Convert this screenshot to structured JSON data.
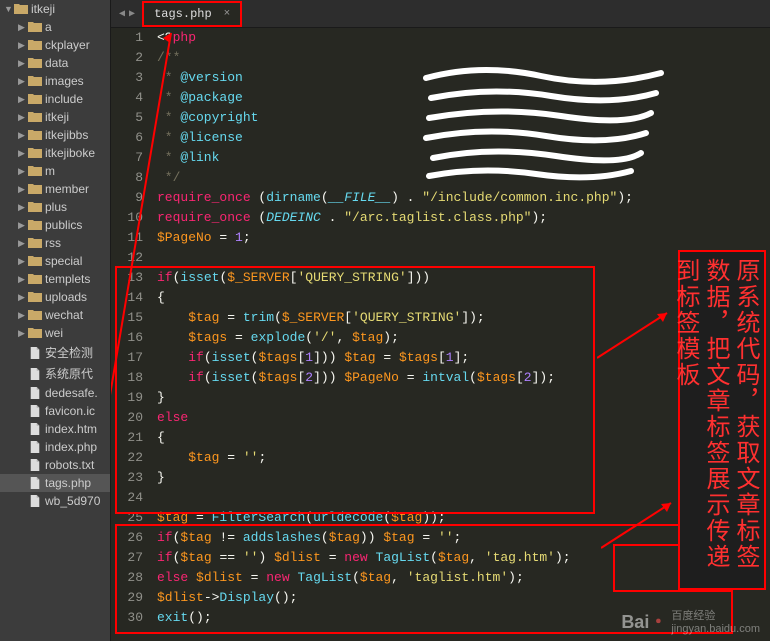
{
  "sidebar": {
    "root": "itkeji",
    "items": [
      {
        "type": "folder",
        "label": "a"
      },
      {
        "type": "folder",
        "label": "ckplayer"
      },
      {
        "type": "folder",
        "label": "data"
      },
      {
        "type": "folder",
        "label": "images"
      },
      {
        "type": "folder",
        "label": "include"
      },
      {
        "type": "folder",
        "label": "itkeji"
      },
      {
        "type": "folder",
        "label": "itkejibbs"
      },
      {
        "type": "folder",
        "label": "itkejiboke"
      },
      {
        "type": "folder",
        "label": "m"
      },
      {
        "type": "folder",
        "label": "member"
      },
      {
        "type": "folder",
        "label": "plus"
      },
      {
        "type": "folder",
        "label": "publics"
      },
      {
        "type": "folder",
        "label": "rss"
      },
      {
        "type": "folder",
        "label": "special"
      },
      {
        "type": "folder",
        "label": "templets"
      },
      {
        "type": "folder",
        "label": "uploads"
      },
      {
        "type": "folder",
        "label": "wechat"
      },
      {
        "type": "folder",
        "label": "wei"
      },
      {
        "type": "file",
        "label": "安全检测"
      },
      {
        "type": "file",
        "label": "系统原代"
      },
      {
        "type": "file",
        "label": "dedesafe."
      },
      {
        "type": "file",
        "label": "favicon.ic"
      },
      {
        "type": "file",
        "label": "index.htm"
      },
      {
        "type": "file",
        "label": "index.php"
      },
      {
        "type": "file",
        "label": "robots.txt"
      },
      {
        "type": "file",
        "label": "tags.php",
        "selected": true
      },
      {
        "type": "file",
        "label": "wb_5d970"
      }
    ]
  },
  "tab": {
    "label": "tags.php"
  },
  "code": {
    "lines": [
      {
        "n": 1,
        "t": [
          {
            "c": "punct",
            "s": "<?"
          },
          {
            "c": "keyword",
            "s": "php"
          }
        ]
      },
      {
        "n": 2,
        "t": [
          {
            "c": "comment",
            "s": "/**"
          }
        ]
      },
      {
        "n": 3,
        "t": [
          {
            "c": "comment",
            "s": " * "
          },
          {
            "c": "doctag",
            "s": "@version"
          }
        ]
      },
      {
        "n": 4,
        "t": [
          {
            "c": "comment",
            "s": " * "
          },
          {
            "c": "doctag",
            "s": "@package"
          }
        ]
      },
      {
        "n": 5,
        "t": [
          {
            "c": "comment",
            "s": " * "
          },
          {
            "c": "doctag",
            "s": "@copyright"
          }
        ]
      },
      {
        "n": 6,
        "t": [
          {
            "c": "comment",
            "s": " * "
          },
          {
            "c": "doctag",
            "s": "@license"
          }
        ]
      },
      {
        "n": 7,
        "t": [
          {
            "c": "comment",
            "s": " * "
          },
          {
            "c": "doctag",
            "s": "@link"
          }
        ]
      },
      {
        "n": 8,
        "t": [
          {
            "c": "comment",
            "s": " */"
          }
        ]
      },
      {
        "n": 9,
        "t": [
          {
            "c": "keyword",
            "s": "require_once"
          },
          {
            "c": "punct",
            "s": " ("
          },
          {
            "c": "func",
            "s": "dirname"
          },
          {
            "c": "punct",
            "s": "("
          },
          {
            "c": "const",
            "s": "__FILE__"
          },
          {
            "c": "punct",
            "s": ") . "
          },
          {
            "c": "string",
            "s": "\"/include/common.inc.php\""
          },
          {
            "c": "punct",
            "s": ");"
          }
        ]
      },
      {
        "n": 10,
        "t": [
          {
            "c": "keyword",
            "s": "require_once"
          },
          {
            "c": "punct",
            "s": " ("
          },
          {
            "c": "const",
            "s": "DEDEINC"
          },
          {
            "c": "punct",
            "s": " . "
          },
          {
            "c": "string",
            "s": "\"/arc.taglist.class.php\""
          },
          {
            "c": "punct",
            "s": ");"
          }
        ]
      },
      {
        "n": 11,
        "t": [
          {
            "c": "var",
            "s": "$PageNo"
          },
          {
            "c": "punct",
            "s": " = "
          },
          {
            "c": "num",
            "s": "1"
          },
          {
            "c": "punct",
            "s": ";"
          }
        ]
      },
      {
        "n": 12,
        "t": []
      },
      {
        "n": 13,
        "t": [
          {
            "c": "keyword",
            "s": "if"
          },
          {
            "c": "punct",
            "s": "("
          },
          {
            "c": "func",
            "s": "isset"
          },
          {
            "c": "punct",
            "s": "("
          },
          {
            "c": "var",
            "s": "$_SERVER"
          },
          {
            "c": "punct",
            "s": "["
          },
          {
            "c": "string",
            "s": "'QUERY_STRING'"
          },
          {
            "c": "punct",
            "s": "]))"
          }
        ]
      },
      {
        "n": 14,
        "t": [
          {
            "c": "punct",
            "s": "{"
          }
        ]
      },
      {
        "n": 15,
        "t": [
          {
            "c": "punct",
            "s": "    "
          },
          {
            "c": "var",
            "s": "$tag"
          },
          {
            "c": "punct",
            "s": " = "
          },
          {
            "c": "func",
            "s": "trim"
          },
          {
            "c": "punct",
            "s": "("
          },
          {
            "c": "var",
            "s": "$_SERVER"
          },
          {
            "c": "punct",
            "s": "["
          },
          {
            "c": "string",
            "s": "'QUERY_STRING'"
          },
          {
            "c": "punct",
            "s": "]);"
          }
        ]
      },
      {
        "n": 16,
        "t": [
          {
            "c": "punct",
            "s": "    "
          },
          {
            "c": "var",
            "s": "$tags"
          },
          {
            "c": "punct",
            "s": " = "
          },
          {
            "c": "func",
            "s": "explode"
          },
          {
            "c": "punct",
            "s": "("
          },
          {
            "c": "string",
            "s": "'/'"
          },
          {
            "c": "punct",
            "s": ", "
          },
          {
            "c": "var",
            "s": "$tag"
          },
          {
            "c": "punct",
            "s": ");"
          }
        ]
      },
      {
        "n": 17,
        "t": [
          {
            "c": "punct",
            "s": "    "
          },
          {
            "c": "keyword",
            "s": "if"
          },
          {
            "c": "punct",
            "s": "("
          },
          {
            "c": "func",
            "s": "isset"
          },
          {
            "c": "punct",
            "s": "("
          },
          {
            "c": "var",
            "s": "$tags"
          },
          {
            "c": "punct",
            "s": "["
          },
          {
            "c": "num",
            "s": "1"
          },
          {
            "c": "punct",
            "s": "])) "
          },
          {
            "c": "var",
            "s": "$tag"
          },
          {
            "c": "punct",
            "s": " = "
          },
          {
            "c": "var",
            "s": "$tags"
          },
          {
            "c": "punct",
            "s": "["
          },
          {
            "c": "num",
            "s": "1"
          },
          {
            "c": "punct",
            "s": "];"
          }
        ]
      },
      {
        "n": 18,
        "t": [
          {
            "c": "punct",
            "s": "    "
          },
          {
            "c": "keyword",
            "s": "if"
          },
          {
            "c": "punct",
            "s": "("
          },
          {
            "c": "func",
            "s": "isset"
          },
          {
            "c": "punct",
            "s": "("
          },
          {
            "c": "var",
            "s": "$tags"
          },
          {
            "c": "punct",
            "s": "["
          },
          {
            "c": "num",
            "s": "2"
          },
          {
            "c": "punct",
            "s": "])) "
          },
          {
            "c": "var",
            "s": "$PageNo"
          },
          {
            "c": "punct",
            "s": " = "
          },
          {
            "c": "func",
            "s": "intval"
          },
          {
            "c": "punct",
            "s": "("
          },
          {
            "c": "var",
            "s": "$tags"
          },
          {
            "c": "punct",
            "s": "["
          },
          {
            "c": "num",
            "s": "2"
          },
          {
            "c": "punct",
            "s": "]);"
          }
        ]
      },
      {
        "n": 19,
        "t": [
          {
            "c": "punct",
            "s": "}"
          }
        ]
      },
      {
        "n": 20,
        "t": [
          {
            "c": "keyword",
            "s": "else"
          }
        ]
      },
      {
        "n": 21,
        "t": [
          {
            "c": "punct",
            "s": "{"
          }
        ]
      },
      {
        "n": 22,
        "t": [
          {
            "c": "punct",
            "s": "    "
          },
          {
            "c": "var",
            "s": "$tag"
          },
          {
            "c": "punct",
            "s": " = "
          },
          {
            "c": "string",
            "s": "''"
          },
          {
            "c": "punct",
            "s": ";"
          }
        ]
      },
      {
        "n": 23,
        "t": [
          {
            "c": "punct",
            "s": "}"
          }
        ]
      },
      {
        "n": 24,
        "t": []
      },
      {
        "n": 25,
        "t": [
          {
            "c": "var",
            "s": "$tag"
          },
          {
            "c": "punct",
            "s": " = "
          },
          {
            "c": "func",
            "s": "FilterSearch"
          },
          {
            "c": "punct",
            "s": "("
          },
          {
            "c": "func",
            "s": "urldecode"
          },
          {
            "c": "punct",
            "s": "("
          },
          {
            "c": "var",
            "s": "$tag"
          },
          {
            "c": "punct",
            "s": "));"
          }
        ]
      },
      {
        "n": 26,
        "t": [
          {
            "c": "keyword",
            "s": "if"
          },
          {
            "c": "punct",
            "s": "("
          },
          {
            "c": "var",
            "s": "$tag"
          },
          {
            "c": "punct",
            "s": " != "
          },
          {
            "c": "func",
            "s": "addslashes"
          },
          {
            "c": "punct",
            "s": "("
          },
          {
            "c": "var",
            "s": "$tag"
          },
          {
            "c": "punct",
            "s": ")) "
          },
          {
            "c": "var",
            "s": "$tag"
          },
          {
            "c": "punct",
            "s": " = "
          },
          {
            "c": "string",
            "s": "''"
          },
          {
            "c": "punct",
            "s": ";"
          }
        ]
      },
      {
        "n": 27,
        "t": [
          {
            "c": "keyword",
            "s": "if"
          },
          {
            "c": "punct",
            "s": "("
          },
          {
            "c": "var",
            "s": "$tag"
          },
          {
            "c": "punct",
            "s": " == "
          },
          {
            "c": "string",
            "s": "''"
          },
          {
            "c": "punct",
            "s": ") "
          },
          {
            "c": "var",
            "s": "$dlist"
          },
          {
            "c": "punct",
            "s": " = "
          },
          {
            "c": "keyword",
            "s": "new"
          },
          {
            "c": "punct",
            "s": " "
          },
          {
            "c": "func",
            "s": "TagList"
          },
          {
            "c": "punct",
            "s": "("
          },
          {
            "c": "var",
            "s": "$tag"
          },
          {
            "c": "punct",
            "s": ", "
          },
          {
            "c": "string",
            "s": "'tag.htm'"
          },
          {
            "c": "punct",
            "s": ");"
          }
        ]
      },
      {
        "n": 28,
        "t": [
          {
            "c": "keyword",
            "s": "else"
          },
          {
            "c": "punct",
            "s": " "
          },
          {
            "c": "var",
            "s": "$dlist"
          },
          {
            "c": "punct",
            "s": " = "
          },
          {
            "c": "keyword",
            "s": "new"
          },
          {
            "c": "punct",
            "s": " "
          },
          {
            "c": "func",
            "s": "TagList"
          },
          {
            "c": "punct",
            "s": "("
          },
          {
            "c": "var",
            "s": "$tag"
          },
          {
            "c": "punct",
            "s": ", "
          },
          {
            "c": "string",
            "s": "'taglist.htm'"
          },
          {
            "c": "punct",
            "s": ");"
          }
        ]
      },
      {
        "n": 29,
        "t": [
          {
            "c": "var",
            "s": "$dlist"
          },
          {
            "c": "punct",
            "s": "->"
          },
          {
            "c": "func",
            "s": "Display"
          },
          {
            "c": "punct",
            "s": "();"
          }
        ]
      },
      {
        "n": 30,
        "t": [
          {
            "c": "func",
            "s": "exit"
          },
          {
            "c": "punct",
            "s": "();"
          }
        ]
      }
    ]
  },
  "annotation": {
    "text": "原系统代码，获取文章标签数据，把文章标签展示传递到标签模板"
  },
  "watermark": {
    "brand": "Bai",
    "brand2": "百度",
    "sub": "经验",
    "url": "jingyan.baidu.com"
  }
}
